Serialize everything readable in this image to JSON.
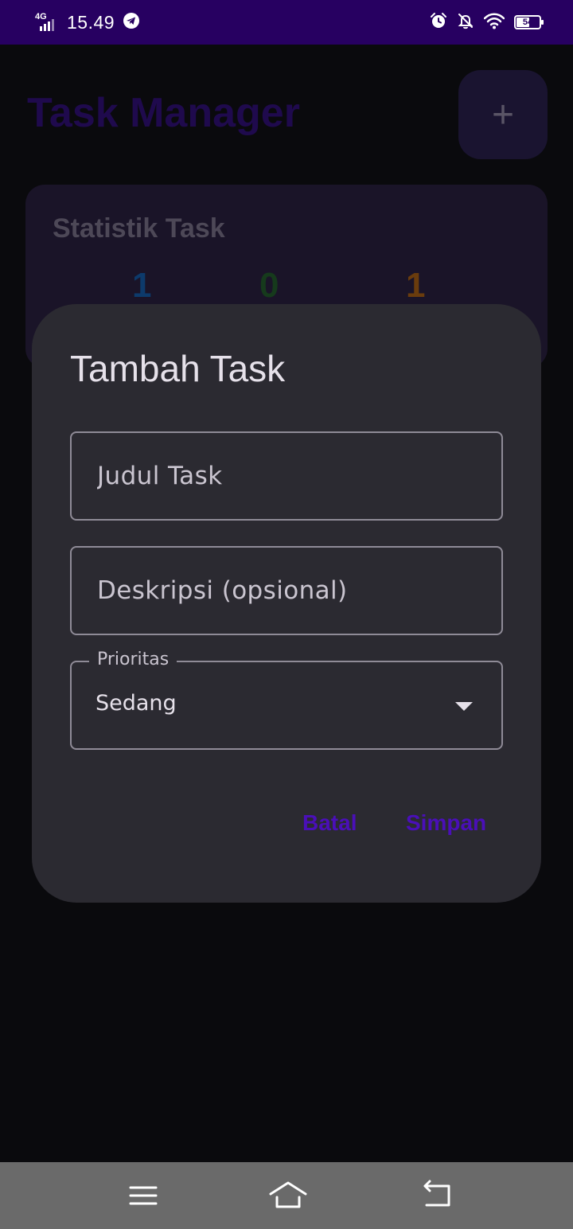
{
  "status_bar": {
    "network": "4G",
    "time": "15.49",
    "battery": "54"
  },
  "app": {
    "title": "Task Manager",
    "add_button": "+"
  },
  "stats": {
    "title": "Statistik Task",
    "values": [
      "1",
      "0",
      "1"
    ]
  },
  "dialog": {
    "title": "Tambah Task",
    "title_field": {
      "placeholder": "Judul Task",
      "value": ""
    },
    "description_field": {
      "placeholder": "Deskripsi (opsional)",
      "value": ""
    },
    "priority_field": {
      "label": "Prioritas",
      "selected": "Sedang"
    },
    "cancel_label": "Batal",
    "save_label": "Simpan"
  },
  "colors": {
    "status_bar": "#270061",
    "dialog_bg": "#2b2a31",
    "accent": "#4a0fb8"
  },
  "icons": [
    "telegram-icon",
    "alarm-icon",
    "bell-off-icon",
    "wifi-icon",
    "battery-icon",
    "menu-icon",
    "home-icon",
    "back-icon"
  ]
}
